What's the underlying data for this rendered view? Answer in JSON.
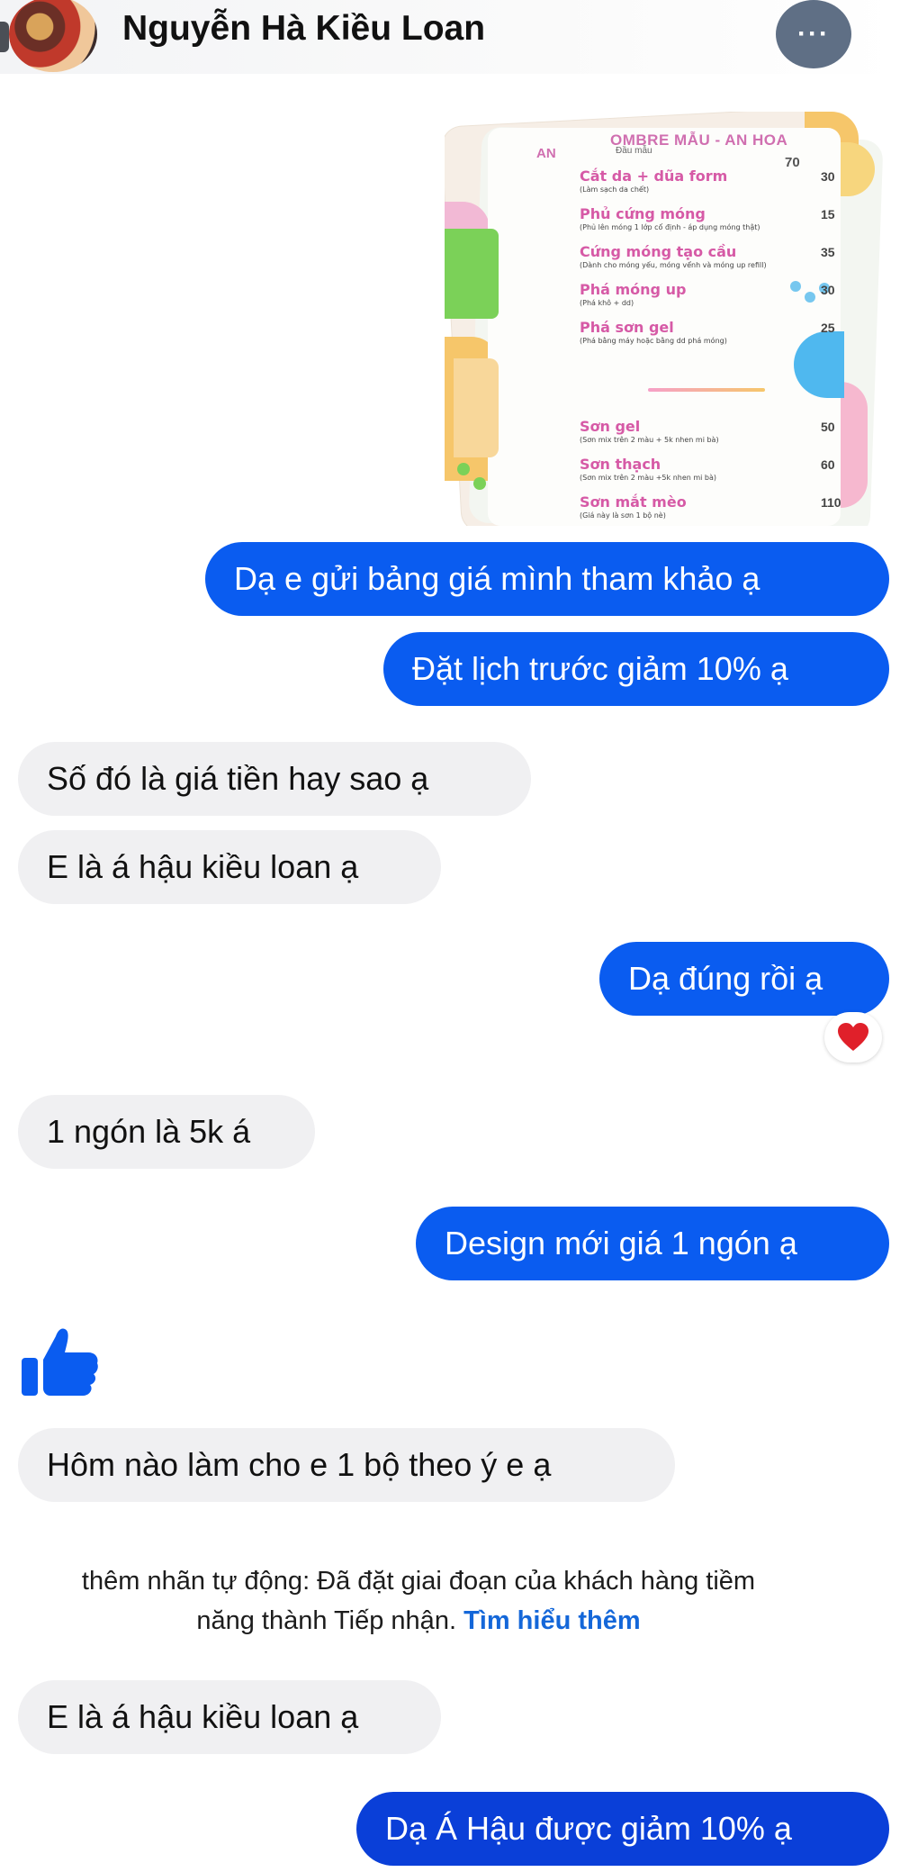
{
  "header": {
    "contact_name": "Nguyễn Hà Kiều Loan",
    "more_icon": "more-horizontal-icon",
    "more_label": "···"
  },
  "price_list": {
    "title": "OMBRE MẪU - AN HOA",
    "subtitle": "Đầu mẫu",
    "left_fragment": "AN",
    "top_price": "70",
    "items": [
      {
        "name": "Cắt da + dũa form",
        "desc": "(Làm sạch da chết)",
        "price": "30"
      },
      {
        "name": "Phủ cứng móng",
        "desc": "(Phủ lên móng 1 lớp cố định - áp dụng móng thật)",
        "price": "15"
      },
      {
        "name": "Cứng móng tạo cầu",
        "desc": "(Dành cho móng yếu, móng vểnh và móng up refill)",
        "price": "35"
      },
      {
        "name": "Phá móng up",
        "desc": "(Phá khô + dd)",
        "price": "30"
      },
      {
        "name": "Phá sơn gel",
        "desc": "(Phá bằng máy hoặc bằng dd phá móng)",
        "price": "25"
      },
      {
        "name": "Sơn gel",
        "desc": "(Sơn mix trên 2 màu + 5k nhen mi bà)",
        "price": "50"
      },
      {
        "name": "Sơn thạch",
        "desc": "(Sơn mix trên 2 màu +5k nhen mi bà)",
        "price": "60"
      },
      {
        "name": "Sơn mắt mèo",
        "desc": "(Giá này là sơn 1 bộ nè)",
        "price": "110"
      }
    ]
  },
  "messages": [
    {
      "id": "m1",
      "direction": "outgoing",
      "text": "Dạ e gửi bảng giá mình tham khảo ạ"
    },
    {
      "id": "m2",
      "direction": "outgoing",
      "text": "Đặt lịch trước giảm 10% ạ"
    },
    {
      "id": "m3",
      "direction": "incoming",
      "text": "Số đó là giá tiền hay sao ạ"
    },
    {
      "id": "m4",
      "direction": "incoming",
      "text": "E là á hậu kiều loan ạ"
    },
    {
      "id": "m5",
      "direction": "outgoing",
      "text": "Dạ đúng rồi ạ",
      "reaction": "heart-icon"
    },
    {
      "id": "m6",
      "direction": "incoming",
      "text": "1 ngón là 5k á"
    },
    {
      "id": "m7",
      "direction": "outgoing",
      "text": "Design mới giá 1 ngón ạ"
    },
    {
      "id": "m8",
      "direction": "incoming",
      "type": "like",
      "icon": "thumbs-up-icon"
    },
    {
      "id": "m9",
      "direction": "incoming",
      "text": "Hôm nào làm cho e 1 bộ theo ý e ạ"
    },
    {
      "id": "m10",
      "direction": "incoming",
      "text": "E là á hậu kiều loan ạ"
    },
    {
      "id": "m11",
      "direction": "outgoing",
      "text": "Dạ Á Hậu được giảm 10% ạ"
    }
  ],
  "system_note": {
    "line1": "thêm nhãn tự động: Đã đặt giai đoạn của khách hàng tiềm",
    "line2": "năng thành Tiếp nhận.",
    "link": "Tìm hiểu thêm"
  },
  "colors": {
    "outgoing": "#0a5cf0",
    "incoming": "#f0f0f2",
    "link": "#1467d9",
    "heart": "#e0202a"
  }
}
